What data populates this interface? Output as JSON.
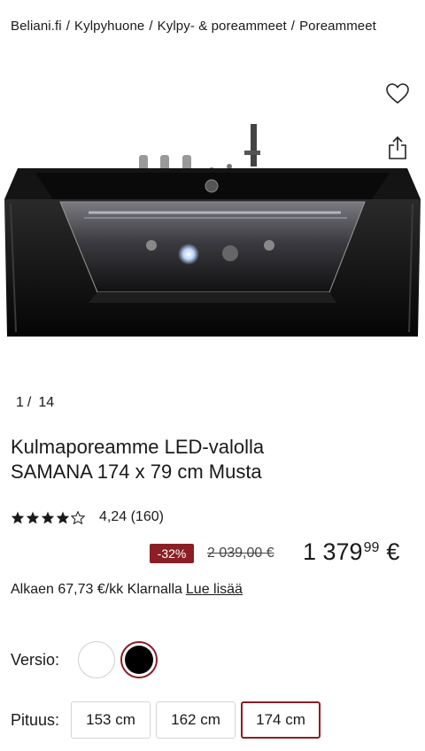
{
  "breadcrumb": {
    "items": [
      "Beliani.fi",
      "Kylpyhuone",
      "Kylpy- & poreammeet",
      "Poreammeet"
    ],
    "separator": "/"
  },
  "gallery": {
    "current": "1",
    "separator": "/",
    "total": "14",
    "heart_icon": "heart-icon",
    "share_icon": "share-icon"
  },
  "product": {
    "title_line1": "Kulmaporeamme LED-valolla",
    "title_line2": "SAMANA 174 x 79 cm Musta"
  },
  "rating": {
    "stars": 4.24,
    "text": "4,24 (160)"
  },
  "price": {
    "discount": "-32%",
    "old": "2 039,00 €",
    "new_whole": "1 379",
    "new_cents": "99",
    "currency": "€",
    "accent_color": "#8b1f25"
  },
  "klarna": {
    "text": "Alkaen 67,73 €/kk Klarnalla",
    "link": "Lue lisää"
  },
  "version": {
    "label": "Versio:",
    "options": [
      "white",
      "black"
    ],
    "selected": "black"
  },
  "length": {
    "label": "Pituus:",
    "options": [
      "153 cm",
      "162 cm",
      "174 cm"
    ],
    "selected": "174 cm"
  }
}
